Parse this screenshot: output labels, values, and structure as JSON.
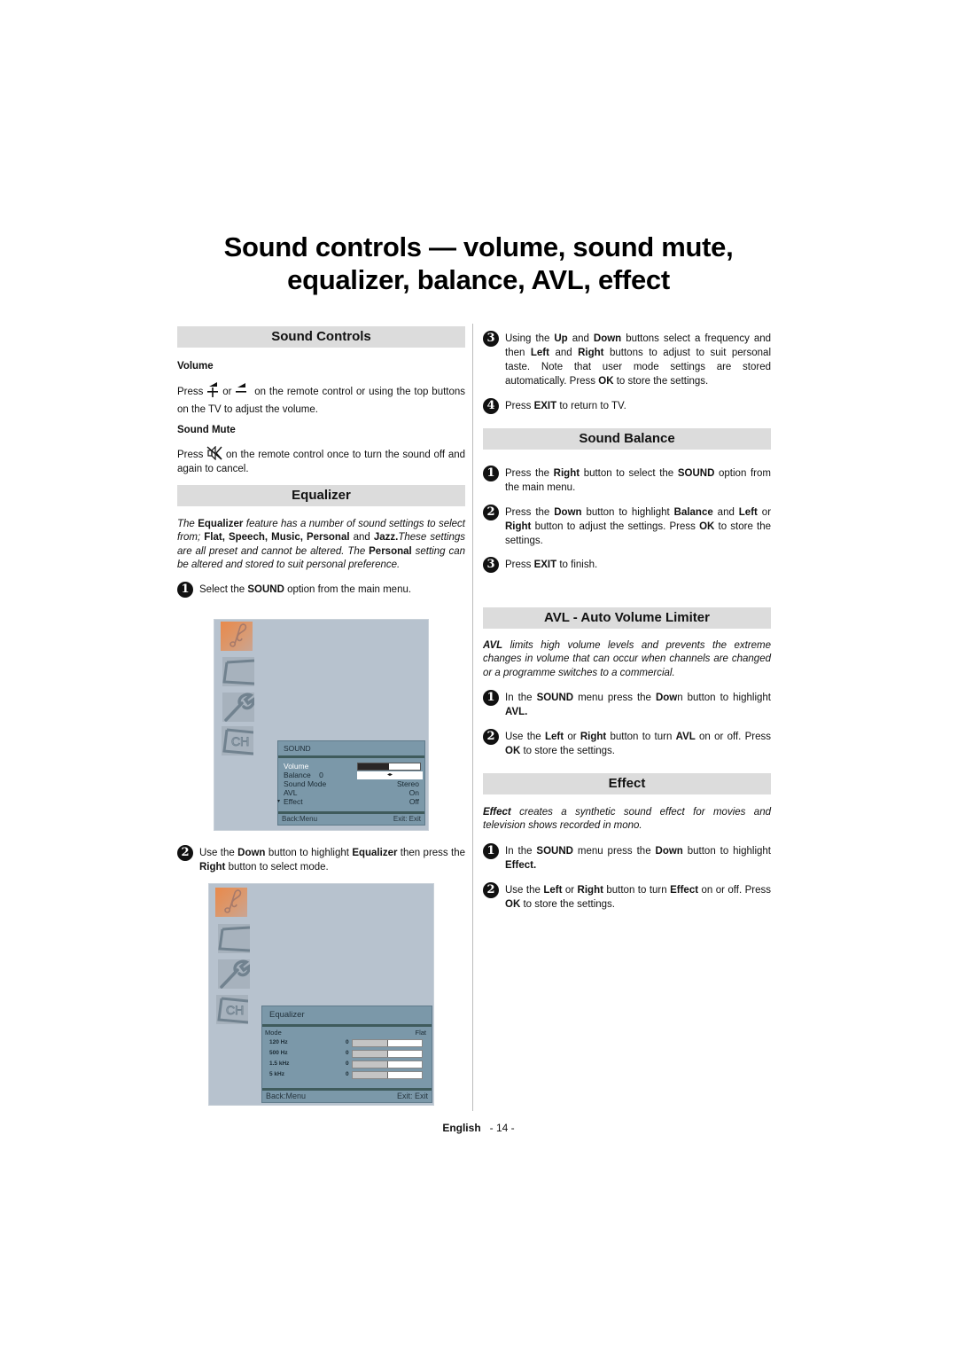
{
  "page": {
    "title_line1": "Sound controls — volume, sound mute,",
    "title_line2": "equalizer, balance, AVL, effect",
    "footer_language": "English",
    "footer_page": "- 14 -"
  },
  "sound_controls": {
    "heading": "Sound Controls",
    "volume_label": "Volume",
    "volume_text_press": "Press",
    "volume_plus_icon": "volume-up-icon",
    "volume_text_or": "or",
    "volume_minus_icon": "volume-down-icon",
    "volume_text_rest": "on the remote control or using the top buttons on the TV to adjust the volume.",
    "mute_label": "Sound Mute",
    "mute_text_press": "Press",
    "mute_icon": "mute-icon",
    "mute_text_rest": "on the remote control once to turn the sound off and again to cancel."
  },
  "equalizer": {
    "heading": "Equalizer",
    "intro": {
      "t1": "The ",
      "b1": "Equalizer",
      "t2": " feature has a number of sound settings to select from; ",
      "b2": "Flat, Speech, Music, Personal",
      "t3": " and ",
      "b3": "Jazz.",
      "t4": "These settings are all preset and cannot be altered. The ",
      "b4": "Personal",
      "t5": " setting can be altered and stored to suit personal preference."
    },
    "step1": {
      "num": "1",
      "t1": "Select the ",
      "b1": "SOUND",
      "t2": " option from the main menu."
    },
    "step2": {
      "num": "2",
      "t1": "Use the ",
      "b1": "Down",
      "t2": " button to highlight ",
      "b2": "Equalizer",
      "t3": " then press the ",
      "b3": "Right",
      "t4": " button to select mode."
    },
    "step3": {
      "num": "3",
      "t1": "Using the ",
      "b1": "Up",
      "t2": " and ",
      "b2": "Down",
      "t3": " buttons select a frequency and then ",
      "b3": "Left",
      "t4": " and ",
      "b4": "Right",
      "t5": " buttons to adjust to suit personal taste. Note that user mode settings are stored automatically. Press ",
      "b5": "OK",
      "t6": " to store the settings."
    },
    "step4": {
      "num": "4",
      "t1": "Press ",
      "b1": "EXIT",
      "t2": " to return to TV."
    }
  },
  "osd_sound": {
    "side_icons": [
      "music-note-icon",
      "picture-icon",
      "wrench-icon",
      "channel-icon"
    ],
    "title": "SOUND",
    "rows": [
      {
        "label": "Volume",
        "value": "",
        "bar_fraction": 0.5
      },
      {
        "label": "Balance    0",
        "value": "",
        "balance_position": 0
      },
      {
        "label": "Sound Mode",
        "value": "Stereo"
      },
      {
        "label": "AVL",
        "value": "On"
      },
      {
        "label": "Effect",
        "value": "Off",
        "arrow": "▾"
      }
    ],
    "footer_left": "Back:Menu",
    "footer_right": "Exit: Exit",
    "balance_arrows": "◂▸"
  },
  "osd_equalizer": {
    "title": "Equalizer",
    "mode_label": "Mode",
    "mode_value": "Flat",
    "bands": [
      {
        "label": "120 Hz",
        "value": "0",
        "level_fraction": 0.5
      },
      {
        "label": "500 Hz",
        "value": "0",
        "level_fraction": 0.5
      },
      {
        "label": "1.5 kHz",
        "value": "0",
        "level_fraction": 0.5
      },
      {
        "label": "5 kHz",
        "value": "0",
        "level_fraction": 0.5
      }
    ],
    "footer_left": "Back:Menu",
    "footer_right": "Exit: Exit"
  },
  "sound_balance": {
    "heading": "Sound Balance",
    "step1": {
      "num": "1",
      "t1": "Press the ",
      "b1": "Right",
      "t2": " button to select the ",
      "b2": "SOUND",
      "t3": " option from the main menu."
    },
    "step2": {
      "num": "2",
      "t1": "Press the ",
      "b1": "Down",
      "t2": " button to highlight ",
      "b2": "Balance",
      "t3": " and ",
      "b3": "Left",
      "t4": " or ",
      "b4": "Right",
      "t5": " button to adjust the settings. Press ",
      "b5": "OK",
      "t6": " to store the settings."
    },
    "step3": {
      "num": "3",
      "t1": "Press ",
      "b1": "EXIT",
      "t2": " to finish."
    }
  },
  "avl": {
    "heading": "AVL - Auto Volume Limiter",
    "intro_b": "AVL",
    "intro_t": " limits high volume levels and prevents the extreme changes in volume that can occur when channels are changed or a programme switches to a commercial.",
    "step1": {
      "num": "1",
      "t1": "In the ",
      "b1": "SOUND",
      "t2": " menu press the ",
      "b2": "Dow",
      "t3": "n button to highlight ",
      "b3": "AVL."
    },
    "step2": {
      "num": "2",
      "t1": "Use the ",
      "b1": "Left",
      "t2": " or ",
      "b2": "Right",
      "t3": " button to turn ",
      "b3": "AVL",
      "t4": " on or off. Press ",
      "b4": "OK",
      "t5": " to store the settings."
    }
  },
  "effect": {
    "heading": "Effect",
    "intro_b": "Effect",
    "intro_t": " creates a synthetic sound effect for movies and television shows recorded in mono.",
    "step1": {
      "num": "1",
      "t1": "In the ",
      "b1": "SOUND",
      "t2": " menu press the ",
      "b2": "Down",
      "t3": " button to highlight ",
      "b3": "Effect."
    },
    "step2": {
      "num": "2",
      "t1": "Use the ",
      "b1": "Left",
      "t2": " or ",
      "b2": "Right",
      "t3": " button to turn ",
      "b3": "Effect",
      "t4": " on or off. Press ",
      "b4": "OK",
      "t5": " to store the settings."
    }
  }
}
